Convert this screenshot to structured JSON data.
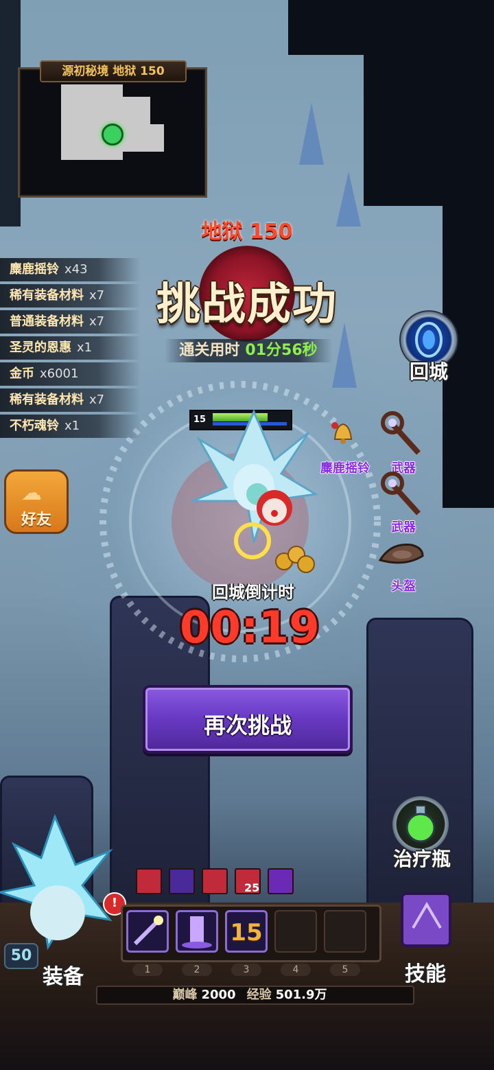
{
  "minimap": {
    "title": "源初秘境 地狱 150"
  },
  "result": {
    "difficulty": "地狱 150",
    "headline": "挑战成功",
    "clear_time_label": "通关用时",
    "clear_time_value": "01分56秒"
  },
  "loot": [
    {
      "name": "麋鹿摇铃",
      "qty": "x43"
    },
    {
      "name": "稀有装备材料",
      "qty": "x7"
    },
    {
      "name": "普通装备材料",
      "qty": "x7"
    },
    {
      "name": "圣灵的恩惠",
      "qty": "x1"
    },
    {
      "name": "金币",
      "qty": "x6001"
    },
    {
      "name": "稀有装备材料",
      "qty": "x7"
    },
    {
      "name": "不朽魂铃",
      "qty": "x1"
    }
  ],
  "friend_button": "好友",
  "return_button": "回城",
  "drops": [
    {
      "label": "麋鹿摇铃",
      "icon": "bell-icon",
      "color": "#8a2ae0"
    },
    {
      "label": "武器",
      "icon": "staff-icon",
      "color": "#8a2ae0"
    },
    {
      "label": "武器",
      "icon": "staff-icon",
      "color": "#8a2ae0"
    },
    {
      "label": "头盔",
      "icon": "helmet-icon",
      "color": "#8a2ae0"
    }
  ],
  "player": {
    "level": "15",
    "hp_fraction": 0.74
  },
  "countdown": {
    "label": "回城倒计时",
    "time": "00:19"
  },
  "retry_button": "再次挑战",
  "potion_button": "治疗瓶",
  "buffs": {
    "stack_count": "25"
  },
  "skills": {
    "slot3_count": "15",
    "slot_numbers": [
      "1",
      "2",
      "3",
      "4",
      "5"
    ]
  },
  "equip_button": "装备",
  "hero_level": "50",
  "skill_button": "技能",
  "exp": {
    "peak_label": "巅峰",
    "peak_value": "2000",
    "exp_label": "经验",
    "exp_value": "501.9万"
  },
  "colors": {
    "accent_red": "#ff3a2a",
    "clear_time_green": "#8ef04a",
    "retry_purple": "#6a3bc6",
    "friend_orange": "#f3a83a"
  }
}
